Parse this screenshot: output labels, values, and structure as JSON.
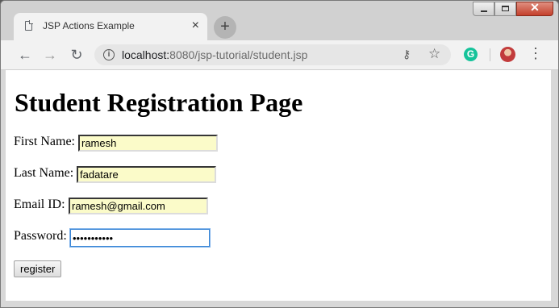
{
  "browser": {
    "tab_title": "JSP Actions Example",
    "tab_close_glyph": "×",
    "new_tab_glyph": "+",
    "url_host": "localhost:",
    "url_path": "8080/jsp-tutorial/student.jsp",
    "back_glyph": "←",
    "forward_glyph": "→",
    "reload_glyph": "↻",
    "info_glyph": "i",
    "key_glyph": "⚷",
    "star_glyph": "☆",
    "extension_glyph": "G",
    "menu_glyph": "⋮",
    "close_glyph": "✕",
    "icons": [
      "file-icon",
      "close-icon",
      "new-tab-icon",
      "back-icon",
      "forward-icon",
      "reload-icon",
      "info-icon",
      "key-icon",
      "star-icon",
      "grammarly-icon",
      "avatar",
      "menu-icon",
      "minimize-icon",
      "maximize-icon",
      "window-close-icon"
    ]
  },
  "page": {
    "heading": "Student Registration Page",
    "fields": {
      "first_name": {
        "label": "First Name:",
        "value": "ramesh"
      },
      "last_name": {
        "label": "Last Name:",
        "value": "fadatare"
      },
      "email": {
        "label": "Email ID:",
        "value": "ramesh@gmail.com"
      },
      "password": {
        "label": "Password:",
        "value": "•••••••••••"
      }
    },
    "submit_label": "register"
  },
  "colors": {
    "autofill_bg": "#fbfbc9",
    "focus_border": "#3a86d6",
    "grammarly": "#15c39a",
    "close_button": "#c4402c"
  }
}
